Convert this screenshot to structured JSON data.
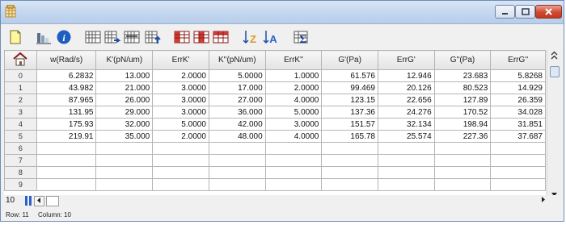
{
  "columns": [
    "",
    "w(Rad/s)",
    "K'(pN/um)",
    "ErrK'",
    "K''(pN/um)",
    "ErrK''",
    "G'(Pa)",
    "ErrG'",
    "G''(Pa)",
    "ErrG''"
  ],
  "rows": [
    {
      "id": "0",
      "cells": [
        "6.2832",
        "13.000",
        "2.0000",
        "5.0000",
        "1.0000",
        "61.576",
        "12.946",
        "23.683",
        "5.8268"
      ]
    },
    {
      "id": "1",
      "cells": [
        "43.982",
        "21.000",
        "3.0000",
        "17.000",
        "2.0000",
        "99.469",
        "20.126",
        "80.523",
        "14.929"
      ]
    },
    {
      "id": "2",
      "cells": [
        "87.965",
        "26.000",
        "3.0000",
        "27.000",
        "4.0000",
        "123.15",
        "22.656",
        "127.89",
        "26.359"
      ]
    },
    {
      "id": "3",
      "cells": [
        "131.95",
        "29.000",
        "3.0000",
        "36.000",
        "5.0000",
        "137.36",
        "24.276",
        "170.52",
        "34.028"
      ]
    },
    {
      "id": "4",
      "cells": [
        "175.93",
        "32.000",
        "5.0000",
        "42.000",
        "3.0000",
        "151.57",
        "32.134",
        "198.94",
        "31.851"
      ]
    },
    {
      "id": "5",
      "cells": [
        "219.91",
        "35.000",
        "2.0000",
        "48.000",
        "4.0000",
        "165.78",
        "25.574",
        "227.36",
        "37.687"
      ]
    },
    {
      "id": "6",
      "cells": [
        "",
        "",
        "",
        "",
        "",
        "",
        "",
        "",
        ""
      ]
    },
    {
      "id": "7",
      "cells": [
        "",
        "",
        "",
        "",
        "",
        "",
        "",
        "",
        ""
      ]
    },
    {
      "id": "8",
      "cells": [
        "",
        "",
        "",
        "",
        "",
        "",
        "",
        "",
        ""
      ]
    },
    {
      "id": "9",
      "cells": [
        "",
        "",
        "",
        "",
        "",
        "",
        "",
        "",
        ""
      ]
    }
  ],
  "footer": {
    "row_count": "10"
  },
  "status": {
    "row": "Row: 11",
    "column": "Column: 10"
  },
  "icons": {
    "titlebar": "grid-app-icon",
    "toolbar": [
      "new-document-icon",
      "column-chart-icon",
      "info-icon",
      "insert-columns-icon",
      "move-columns-icon",
      "delete-columns-icon",
      "append-column-icon",
      "red-table-icon",
      "red-table-icon-2",
      "red-table-icon-3",
      "sort-ascending-icon",
      "sort-descending-icon",
      "sum-icon"
    ],
    "grid_corner": "home-icon"
  },
  "colors": {
    "titlebar": "#c3d6ee",
    "close_button": "#cf4a31",
    "grid_line": "#b5b5b5"
  }
}
